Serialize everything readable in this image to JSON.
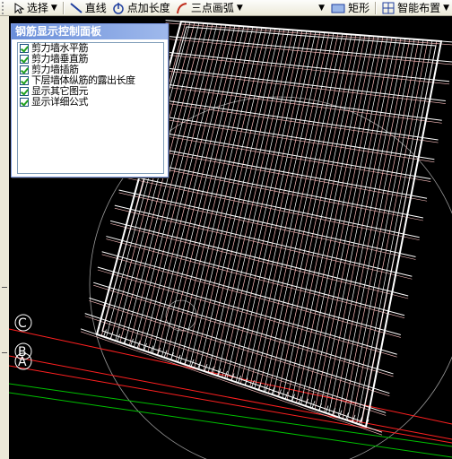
{
  "toolbar": {
    "select_label": "选择",
    "line_label": "直线",
    "point_length_label": "点加长度",
    "three_point_arc_label": "三点画弧",
    "rectangle_label": "矩形",
    "smart_layout_label": "智能布置"
  },
  "panel": {
    "title": "钢筋显示控制面板",
    "options": [
      {
        "label": "剪力墙水平筋",
        "checked": true
      },
      {
        "label": "剪力墙垂直筋",
        "checked": true
      },
      {
        "label": "剪力墙插筋",
        "checked": true
      },
      {
        "label": "下层墙体纵筋的露出长度",
        "checked": true
      },
      {
        "label": "显示其它图元",
        "checked": true
      },
      {
        "label": "显示详细公式",
        "checked": true
      }
    ]
  },
  "axes": {
    "labels": [
      "C",
      "B",
      "A"
    ]
  },
  "colors": {
    "background": "#000000",
    "rebar": "#ffffff",
    "rebar_pink": "#ffc0c0",
    "axis_red": "#ff2020",
    "axis_green": "#00c000",
    "toolbar": "#ece9d8",
    "panel_title": "#6a8ed9"
  }
}
